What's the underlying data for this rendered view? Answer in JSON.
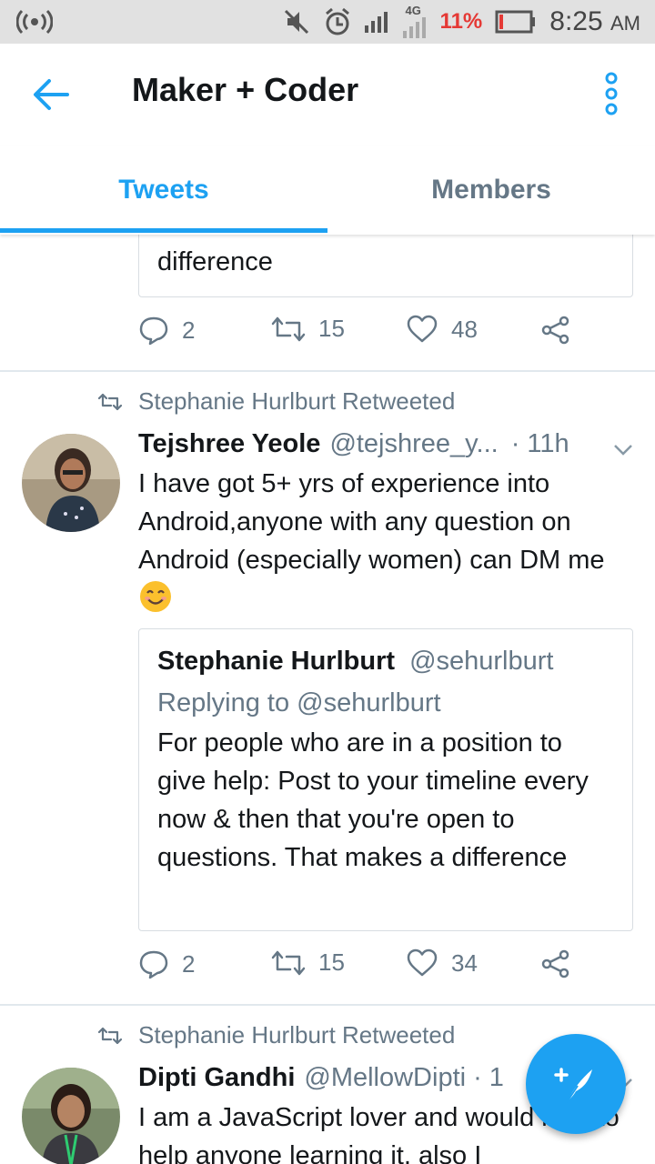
{
  "status_bar": {
    "network": "4G",
    "battery_percent": "11%",
    "time": "8:25",
    "ampm": "AM"
  },
  "header": {
    "title": "Maker + Coder"
  },
  "tabs": [
    {
      "label": "Tweets",
      "active": true
    },
    {
      "label": "Members",
      "active": false
    }
  ],
  "tweet_partial": {
    "quote_last_line": "difference",
    "replies": "2",
    "retweets": "15",
    "likes": "48"
  },
  "tweet_1": {
    "retweeted_by": "Stephanie Hurlburt Retweeted",
    "name": "Tejshree Yeole",
    "handle": "@tejshree_y...",
    "time": "· 11h",
    "text": "I have got 5+ yrs of experience into Android,anyone with any question on Android (especially women) can DM me",
    "quote": {
      "name": "Stephanie Hurlburt",
      "handle": "@sehurlburt",
      "replying_to": "Replying to @sehurlburt",
      "text": "For people who are in a position to give help: Post to your timeline every now & then that you're open to questions. That makes a difference"
    },
    "replies": "2",
    "retweets": "15",
    "likes": "34"
  },
  "tweet_2": {
    "retweeted_by": "Stephanie Hurlburt Retweeted",
    "name": "Dipti Gandhi",
    "handle": "@MellowDipti",
    "time": "· 1",
    "text": "I am a JavaScript lover and would love to help anyone learning it, also I"
  },
  "colors": {
    "accent": "#1da1f2",
    "secondary_text": "#657786",
    "battery_low": "#e53935"
  }
}
